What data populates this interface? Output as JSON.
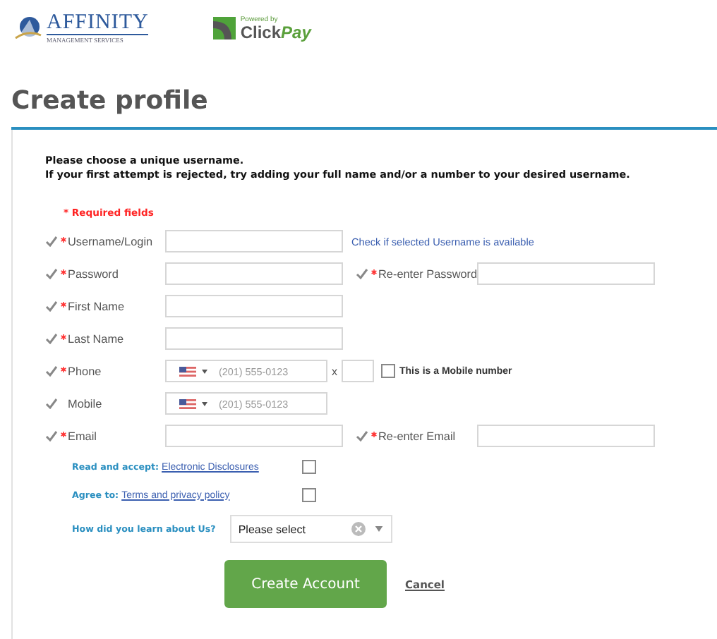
{
  "header": {
    "affinity": {
      "name": "AFFINITY",
      "tagline": "MANAGEMENT SERVICES"
    },
    "clickpay": {
      "powered": "Powered by",
      "word1": "Click",
      "word2": "Pay"
    }
  },
  "title": "Create profile",
  "intro": [
    "Please choose a unique username.",
    "If your first attempt is rejected, try adding your full name and/or a number to your desired username."
  ],
  "required_note": "* Required fields",
  "fields": [
    {
      "kind": "text",
      "label": "Username/Login",
      "required": true,
      "link": "Check if selected Username is available"
    },
    {
      "kind": "text",
      "label": "Password",
      "required": true,
      "second": {
        "label": "Re-enter Password",
        "required": true
      }
    },
    {
      "kind": "text",
      "label": "First Name",
      "required": true
    },
    {
      "kind": "text",
      "label": "Last Name",
      "required": true
    },
    {
      "kind": "phone",
      "label": "Phone",
      "required": true,
      "placeholder": "(201) 555-0123",
      "ext_label": "x",
      "mobile_checkbox": {
        "label": "This is a Mobile number",
        "checked": false
      }
    },
    {
      "kind": "phone",
      "label": "Mobile",
      "required": false,
      "placeholder": "(201) 555-0123"
    },
    {
      "kind": "text",
      "label": "Email",
      "required": true,
      "second": {
        "label": "Re-enter Email",
        "required": true
      }
    }
  ],
  "agreements": [
    {
      "prefix": "Read and accept:",
      "link": "Electronic Disclosures",
      "checked": false
    },
    {
      "prefix": "Agree to:",
      "link": "Terms and privacy policy",
      "checked": false
    }
  ],
  "source": {
    "label": "How did you learn about Us?",
    "value": "Please select"
  },
  "buttons": {
    "submit": "Create Account",
    "cancel": "Cancel"
  }
}
